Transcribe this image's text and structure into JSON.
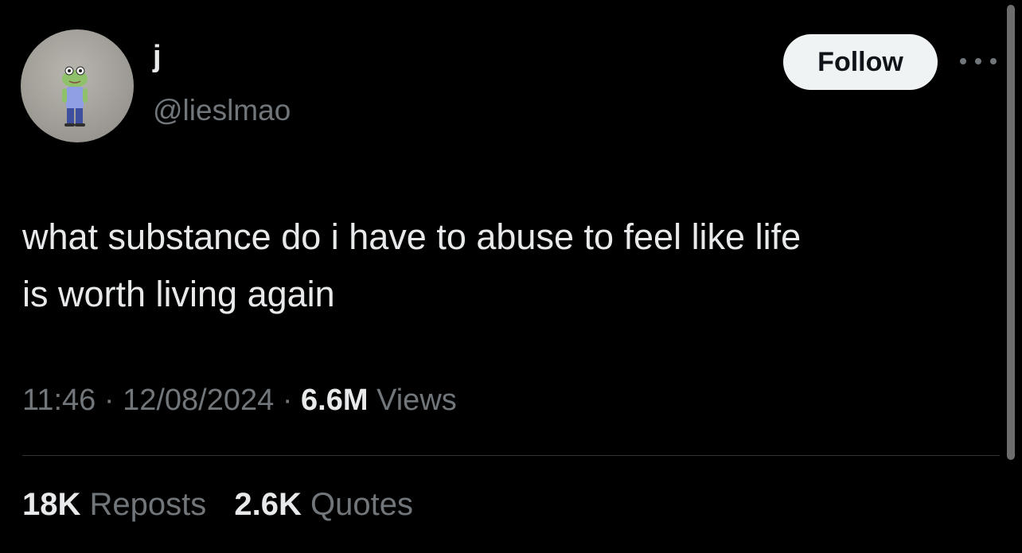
{
  "author": {
    "display_name": "j",
    "handle": "@lieslmao",
    "avatar_icon": "frog-character-avatar"
  },
  "actions": {
    "follow_label": "Follow",
    "more_icon": "more-horizontal-icon"
  },
  "tweet": {
    "text": "what substance do i have to abuse to feel like life\nis worth living again"
  },
  "meta": {
    "time": "11:46",
    "separator": "·",
    "date": "12/08/2024",
    "views_count": "6.6M",
    "views_label": "Views"
  },
  "stats": {
    "reposts_count": "18K",
    "reposts_label": "Reposts",
    "quotes_count": "2.6K",
    "quotes_label": "Quotes"
  },
  "colors": {
    "background": "#000000",
    "primary_text": "#e7e9ea",
    "secondary_text": "#71767b",
    "follow_button_bg": "#eff3f4",
    "divider": "#2f3336"
  }
}
